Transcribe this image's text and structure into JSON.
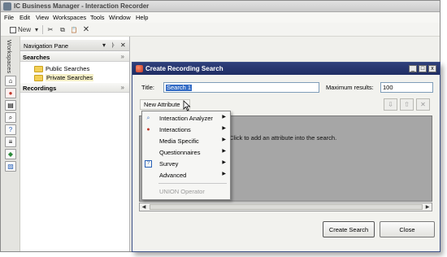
{
  "app": {
    "title": "IC Business Manager - Interaction Recorder"
  },
  "menu": [
    "File",
    "Edit",
    "View",
    "Workspaces",
    "Tools",
    "Window",
    "Help"
  ],
  "toolbar": {
    "new_label": "New",
    "new_dropdown": "▾",
    "cut": "✂",
    "copy": "⧉",
    "paste": "📋",
    "delete": "✕"
  },
  "rail": {
    "label": "Workspaces"
  },
  "nav": {
    "title": "Navigation Pane",
    "controls": [
      "▾",
      "ᚦ",
      "✕"
    ],
    "searches_title": "Searches",
    "searches_chevron": "»",
    "items": [
      "Public Searches",
      "Private Searches"
    ],
    "recordings_title": "Recordings",
    "recordings_chevron": "»"
  },
  "dialog": {
    "title": "Create Recording Search",
    "title_label": "Title:",
    "title_value": "Search 1",
    "max_label": "Maximum results:",
    "max_value": "100",
    "new_attribute": "New Attribute",
    "new_attribute_arrow": "▾",
    "move_down": "⇩",
    "move_up": "⇧",
    "remove": "✕",
    "hint": "Click to add an attribute into the search.",
    "create_button": "Create Search",
    "close_button": "Close",
    "scroll_left": "◀",
    "scroll_right": "▶",
    "win_min": "_",
    "win_max": "□",
    "win_close": "x"
  },
  "attr_menu": {
    "items": [
      {
        "label": "Interaction Analyzer",
        "icon": "magnifier-icon",
        "arrow": "▶"
      },
      {
        "label": "Interactions",
        "icon": "interactions-icon",
        "arrow": "▶"
      },
      {
        "label": "Media Specific",
        "icon": "",
        "arrow": "▶"
      },
      {
        "label": "Questionnaires",
        "icon": "",
        "arrow": "▶"
      },
      {
        "label": "Survey",
        "icon": "survey-icon",
        "arrow": "▶"
      },
      {
        "label": "Advanced",
        "icon": "",
        "arrow": "▶"
      }
    ],
    "operator": "UNION Operator"
  },
  "colors": {
    "dialog_title": "#1f2d63",
    "canvas": "#a6a6a6",
    "selection": "#316ac5"
  }
}
